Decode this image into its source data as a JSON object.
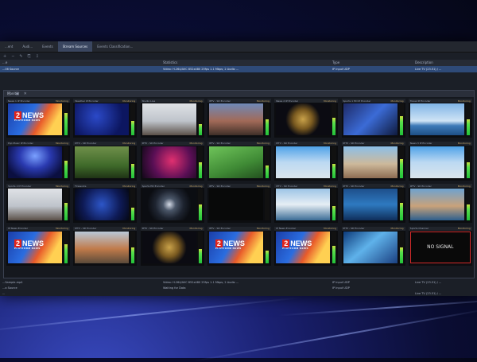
{
  "tabs": [
    "...ent",
    "Audi...",
    "Events",
    "Stream Sources",
    "Events Classification..."
  ],
  "active_tab_index": 3,
  "columns": [
    "...e",
    "Statistics",
    "Type",
    "Description"
  ],
  "top_row": {
    "name": "...06 Source",
    "stats": "Video: H.264/AVC 852x480 25fps 1.1 Mbps; 2 Audio ...",
    "type": "IP Input UDP",
    "desc": "Live TV (23.51) / ..."
  },
  "multiviewer": {
    "title": "Monitor",
    "controls": "□ ▣ ✕",
    "tiles": [
      {
        "name": "News 1 IP Encoder",
        "status": "Monitoring",
        "video": "news",
        "level": 0.7
      },
      {
        "name": "Weather IP Encoder",
        "status": "Monitoring",
        "video": "blue",
        "level": 0.45
      },
      {
        "name": "Studio Live",
        "status": "Monitoring",
        "video": "studio",
        "level": 0.35
      },
      {
        "name": "IPTV - SD Encoder",
        "status": "Monitoring",
        "video": "crowd",
        "level": 0.5
      },
      {
        "name": "News 2 IP Encoder",
        "status": "Monitoring",
        "video": "globe",
        "level": 0.55
      },
      {
        "name": "Sports 1 HD IP Encoder",
        "status": "Monitoring",
        "video": "people",
        "level": 0.6
      },
      {
        "name": "Travel IP Encoder",
        "status": "Monitoring",
        "video": "ship",
        "level": 0.5
      },
      {
        "name": "Pop Music IP Encoder",
        "status": "Monitoring",
        "video": "stage",
        "level": 0.55
      },
      {
        "name": "IPTV - SD Encoder",
        "status": "Monitoring",
        "video": "park",
        "level": 0.45
      },
      {
        "name": "IPTV - SD Encoder",
        "status": "Monitoring",
        "video": "pink",
        "level": 0.5
      },
      {
        "name": "IPTV - SD Encoder",
        "status": "Monitoring",
        "video": "field",
        "level": 0.4
      },
      {
        "name": "IPTV - SD Encoder",
        "status": "Monitoring",
        "video": "gfx",
        "level": 0.45
      },
      {
        "name": "IPTV - SD Encoder",
        "status": "Monitoring",
        "video": "road",
        "level": 0.6
      },
      {
        "name": "News 3 IP Encoder",
        "status": "Monitoring",
        "video": "gfx",
        "level": 0.5
      },
      {
        "name": "Sports 2 IP Encoder",
        "status": "Monitoring",
        "video": "studio",
        "level": 0.55
      },
      {
        "name": "Fireworks",
        "status": "Monitoring",
        "video": "fireworks",
        "level": 0.4
      },
      {
        "name": "Sports HD Encoder",
        "status": "Monitoring",
        "video": "lens",
        "level": 0.5
      },
      {
        "name": "IPTV - SD Encoder",
        "status": "Monitoring",
        "video": "dark",
        "level": 0.0
      },
      {
        "name": "IPTV - SD Encoder",
        "status": "Monitoring",
        "video": "sea",
        "level": 0.45
      },
      {
        "name": "IPTV - SD Encoder",
        "status": "Monitoring",
        "video": "ocean",
        "level": 0.55
      },
      {
        "name": "IPTV - SD Encoder",
        "status": "Monitoring",
        "video": "sea2",
        "level": 0.5
      },
      {
        "name": "IP News Encoder",
        "status": "Monitoring",
        "video": "news",
        "level": 0.6
      },
      {
        "name": "IPTV - SD Encoder",
        "status": "Monitoring",
        "video": "street",
        "level": 0.5
      },
      {
        "name": "IPTV - SD Encoder",
        "status": "Monitoring",
        "video": "globe",
        "level": 0.45
      },
      {
        "name": "IPTV - SD Encoder",
        "status": "Monitoring",
        "video": "news",
        "level": 0.4
      },
      {
        "name": "IP News Encoder",
        "status": "Monitoring",
        "video": "news",
        "level": 0.55
      },
      {
        "name": "IPTV - SD Encoder",
        "status": "Monitoring",
        "video": "glass",
        "level": 0.5
      },
      {
        "name": "Sports Channel",
        "status": "Monitoring",
        "video": "nosignal",
        "level": 0.0
      }
    ],
    "news_logo": {
      "mark": "2",
      "word": "NEWS",
      "sub": "PLATFORM NEWS"
    },
    "no_signal_text": "NO SIGNAL"
  },
  "lower_rows": [
    {
      "name": "...Sample.mp4",
      "stats": "Video: H.264/AVC 852x480 25fps 1.1 Mbps; 2 Audio ...",
      "type": "IP Input UDP",
      "desc": "Live TV (23.51) / ..."
    },
    {
      "name": "...a Source",
      "stats": "Waiting for Data",
      "type": "IP Input UDP",
      "desc": ""
    },
    {
      "name": "...",
      "stats": "",
      "type": "",
      "desc": "Live TV (23.51) / ..."
    }
  ]
}
